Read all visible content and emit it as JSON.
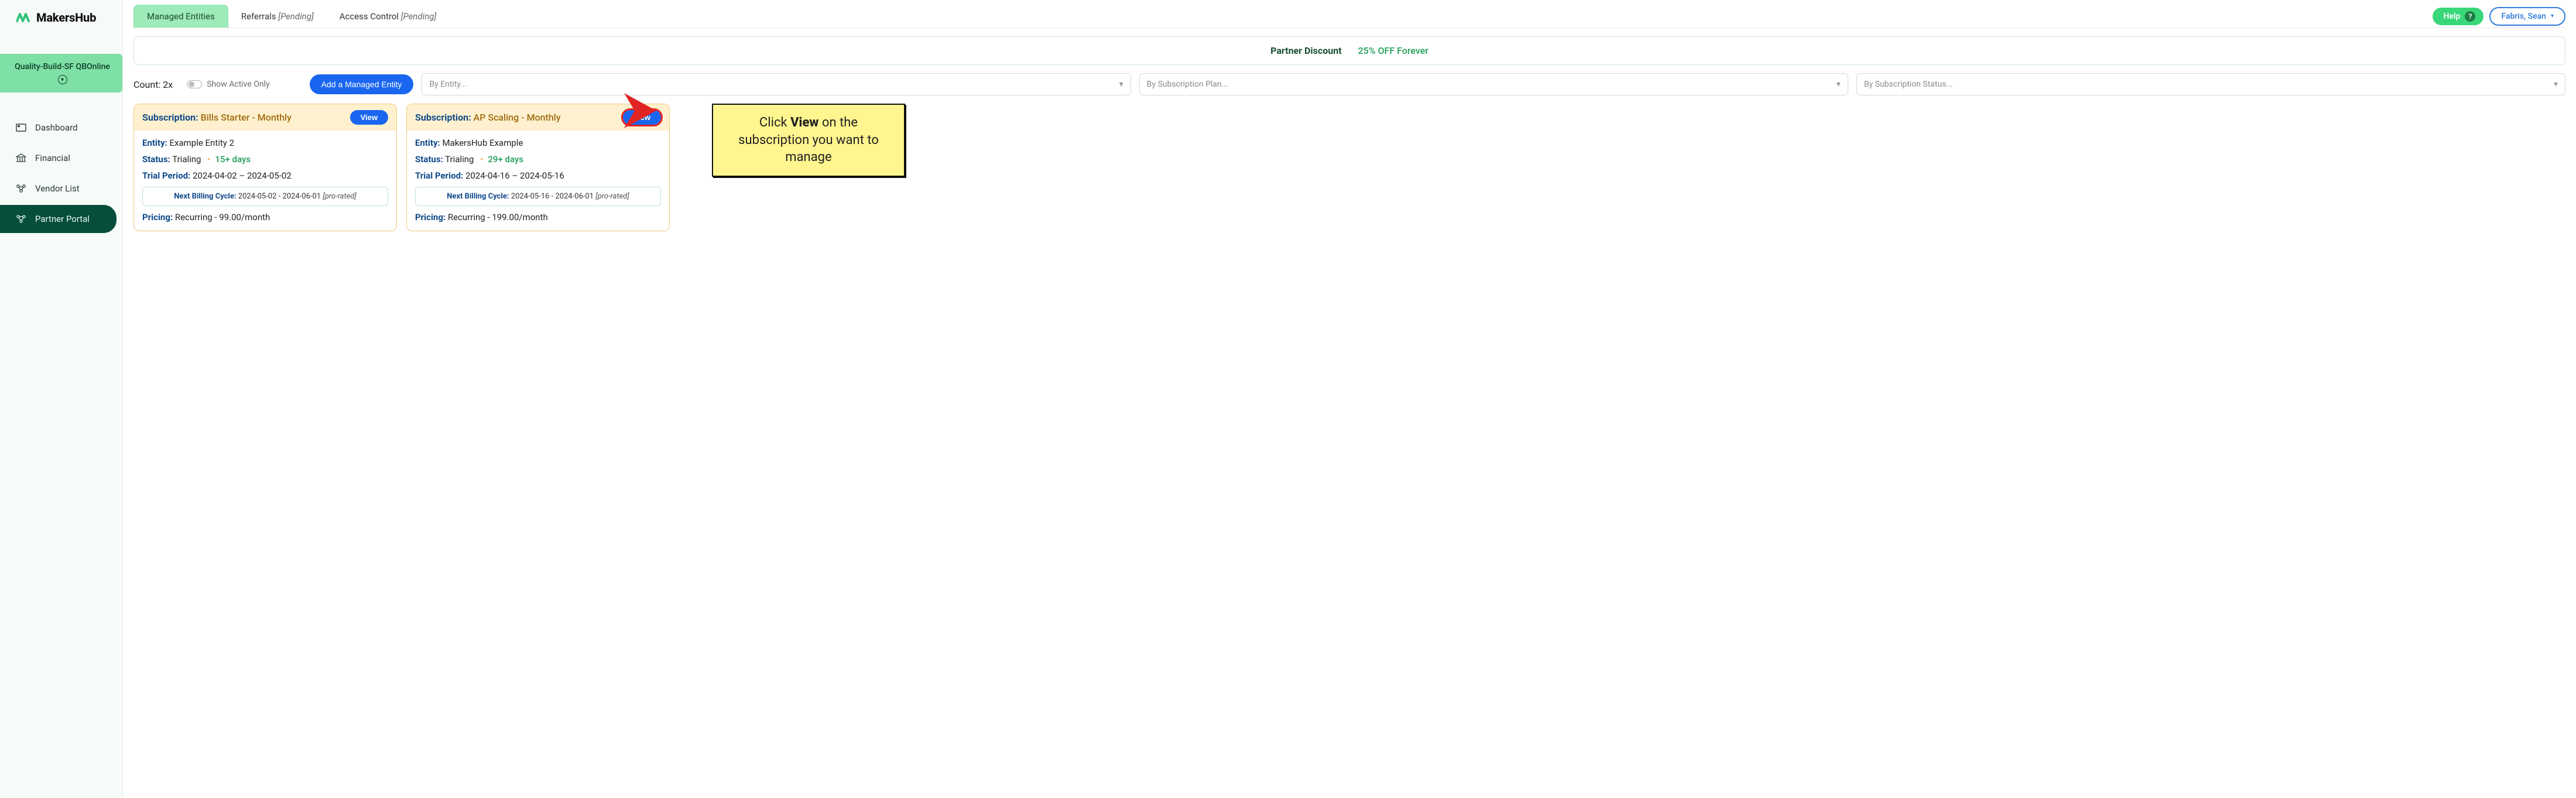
{
  "brand": {
    "name": "MakersHub"
  },
  "org": {
    "name": "Quality-Build-SF QBOnline"
  },
  "nav": {
    "items": [
      {
        "label": "Dashboard"
      },
      {
        "label": "Financial"
      },
      {
        "label": "Vendor List"
      },
      {
        "label": "Partner Portal"
      }
    ],
    "active_index": 3
  },
  "tabs": {
    "items": [
      {
        "label": "Managed Entities",
        "pending": ""
      },
      {
        "label": "Referrals",
        "pending": "[Pending]"
      },
      {
        "label": "Access Control",
        "pending": "[Pending]"
      }
    ],
    "active_index": 0
  },
  "top_actions": {
    "help_label": "Help",
    "user_name": "Fabris, Sean"
  },
  "banner": {
    "title": "Partner Discount",
    "offer": "25% OFF Forever"
  },
  "filters": {
    "count_label": "Count:",
    "count_value": "2x",
    "toggle_label": "Show Active Only",
    "add_button": "Add a Managed Entity",
    "entity_placeholder": "By Entity...",
    "plan_placeholder": "By Subscription Plan...",
    "status_placeholder": "By Subscription Status..."
  },
  "cards": [
    {
      "subscription_label": "Subscription:",
      "subscription_name": "Bills Starter - Monthly",
      "view_label": "View",
      "entity_label": "Entity:",
      "entity_value": "Example Entity 2",
      "status_label": "Status:",
      "status_value": "Trialing",
      "days_left": "15+ days",
      "trial_label": "Trial Period:",
      "trial_value": "2024-04-02 – 2024-05-02",
      "cycle_label": "Next Billing Cycle:",
      "cycle_value": "2024-05-02 - 2024-06-01",
      "cycle_suffix": "[pro-rated]",
      "pricing_label": "Pricing:",
      "pricing_value": "Recurring - 99.00/month",
      "highlight_view": false
    },
    {
      "subscription_label": "Subscription:",
      "subscription_name": "AP Scaling - Monthly",
      "view_label": "View",
      "entity_label": "Entity:",
      "entity_value": "MakersHub Example",
      "status_label": "Status:",
      "status_value": "Trialing",
      "days_left": "29+ days",
      "trial_label": "Trial Period:",
      "trial_value": "2024-04-16 – 2024-05-16",
      "cycle_label": "Next Billing Cycle:",
      "cycle_value": "2024-05-16 - 2024-06-01",
      "cycle_suffix": "[pro-rated]",
      "pricing_label": "Pricing:",
      "pricing_value": "Recurring - 199.00/month",
      "highlight_view": true
    }
  ],
  "annotation": {
    "text_pre": "Click ",
    "text_bold": "View",
    "text_post": " on the subscription you want to manage"
  }
}
